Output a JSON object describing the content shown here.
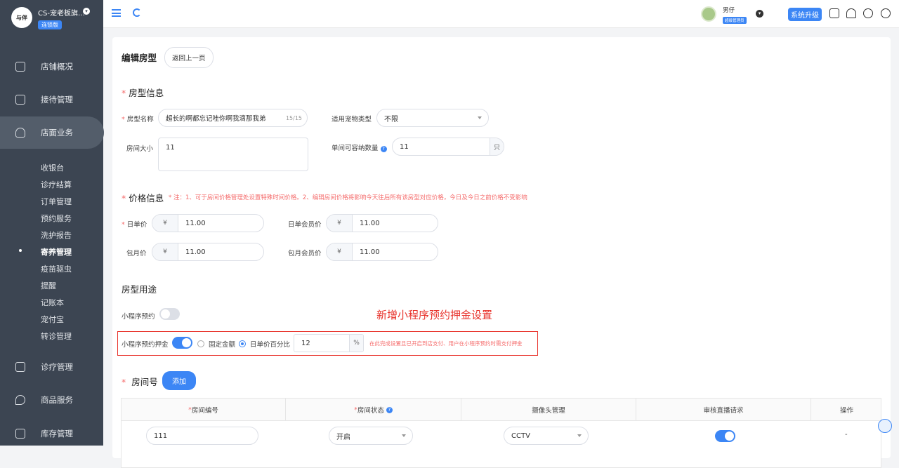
{
  "brand": {
    "name": "CS-宠老板旗…",
    "badge": "连锁版",
    "logo_text": "与伴"
  },
  "nav": [
    {
      "label": "店铺概况",
      "icon": "monitor-icon"
    },
    {
      "label": "接待管理",
      "icon": "clipboard-icon"
    },
    {
      "label": "店面业务",
      "icon": "home-icon"
    },
    {
      "label": "诊疗管理",
      "icon": "medical-kit-icon"
    },
    {
      "label": "商品服务",
      "icon": "location-icon"
    },
    {
      "label": "库存管理",
      "icon": "box-icon"
    }
  ],
  "subnav": [
    "收银台",
    "诊疗结算",
    "订单管理",
    "预约服务",
    "洗护报告",
    "寄养管理",
    "疫苗驱虫",
    "提醒",
    "记账本",
    "宠付宝",
    "转诊管理"
  ],
  "topbar": {
    "user_name": "男仔",
    "user_role": "超级管理员",
    "upgrade": "系统升级"
  },
  "page": {
    "title": "编辑房型",
    "back": "返回上一页"
  },
  "room_info": {
    "section": "房型信息",
    "name_label": "房型名称",
    "name_value": "超长的啊都忘记哇你啊我滴那我弟",
    "name_count": "15/15",
    "pet_type_label": "适用宠物类型",
    "pet_type_value": "不限",
    "size_label": "房间大小",
    "size_value": "11",
    "capacity_label": "单间可容纳数量",
    "capacity_value": "11",
    "capacity_unit": "只"
  },
  "price_info": {
    "section": "价格信息",
    "note": "* 注：1、可于房间价格管理处设置特殊时间价格。2、编辑房间价格将影响今天往后所有该房型对应价格，今日及今日之前价格不受影响",
    "currency": "¥",
    "daily_label": "日单价",
    "daily_value": "11.00",
    "daily_member_label": "日单会员价",
    "daily_member_value": "11.00",
    "monthly_label": "包月价",
    "monthly_value": "11.00",
    "monthly_member_label": "包月会员价",
    "monthly_member_value": "11.00"
  },
  "usage": {
    "section": "房型用途",
    "miniprogram_label": "小程序预约",
    "miniprogram_on": false,
    "annotation": "新增小程序预约押金设置",
    "deposit_label": "小程序预约押金",
    "deposit_on": true,
    "fixed_label": "固定金额",
    "percent_label": "日单价百分比",
    "percent_selected": true,
    "percent_value": "12",
    "percent_unit": "%",
    "deposit_note": "在此完成设置且已开启到店支付、用户在小程序预约时需支付押金"
  },
  "rooms": {
    "section": "房间号",
    "add": "添加",
    "headers": [
      "房间编号",
      "房间状态",
      "摄像头管理",
      "审核直播请求",
      "操作"
    ],
    "row": {
      "number": "111",
      "status": "开启",
      "camera": "CCTV",
      "live_on": true,
      "action": "-"
    }
  },
  "colors": {
    "primary": "#3c86f5",
    "sidebar": "#3c4552",
    "annotation": "#e8322b"
  }
}
